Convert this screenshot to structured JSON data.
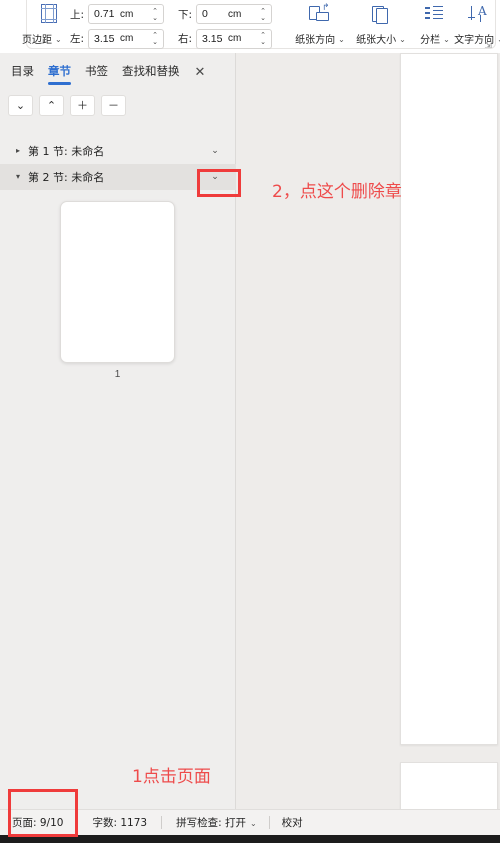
{
  "ribbon": {
    "margin_icon": "page-margins-icon",
    "margin_label": "页边距",
    "fields": [
      {
        "label": "上:",
        "value": "0.71",
        "unit": "cm"
      },
      {
        "label": "下:",
        "value": "0",
        "unit": "cm"
      },
      {
        "label": "左:",
        "value": "3.15",
        "unit": "cm"
      },
      {
        "label": "右:",
        "value": "3.15",
        "unit": "cm"
      }
    ],
    "groups": [
      {
        "label": "纸张方向",
        "icon": "paper-orientation-icon"
      },
      {
        "label": "纸张大小",
        "icon": "paper-size-icon"
      },
      {
        "label": "分栏",
        "icon": "columns-icon"
      },
      {
        "label": "文字方向",
        "icon": "text-direction-icon"
      }
    ],
    "expand_icon": "dialog-launcher-icon",
    "caret": "⌄"
  },
  "nav_panel": {
    "tabs": [
      {
        "label": "目录",
        "active": false
      },
      {
        "label": "章节",
        "active": true
      },
      {
        "label": "书签",
        "active": false
      },
      {
        "label": "查找和替换",
        "active": false
      }
    ],
    "close_label": "✕",
    "toolbar_buttons": [
      {
        "name": "move-down-button",
        "glyph": "⌄"
      },
      {
        "name": "move-up-button",
        "glyph": "⌃"
      },
      {
        "name": "add-section-button",
        "glyph": "＋"
      },
      {
        "name": "remove-section-button",
        "glyph": "－"
      }
    ],
    "sections": [
      {
        "label": "第 1 节: 未命名",
        "triangle": "▸",
        "selected": false,
        "caret": "⌄"
      },
      {
        "label": "第 2 节: 未命名",
        "triangle": "▾",
        "selected": true,
        "caret": "⌄"
      }
    ],
    "thumbnail_page_number": "1"
  },
  "statusbar": {
    "page_label": "页面: 9/10",
    "word_count": "字数: 1173",
    "spellcheck": "拼写检查: 打开",
    "spellcheck_caret": "⌄",
    "proofread": "校对"
  },
  "annotations": [
    {
      "name": "annotation-step-2",
      "text": "2，点这个删除章"
    },
    {
      "name": "annotation-step-1",
      "text": "1点击页面"
    }
  ],
  "colors": {
    "accent_blue": "#2f6fd0",
    "annotation_red": "#ee4b4b",
    "panel_bg": "#efeeed",
    "canvas_bg": "#eeecea",
    "selected_row": "#e3e1df"
  }
}
